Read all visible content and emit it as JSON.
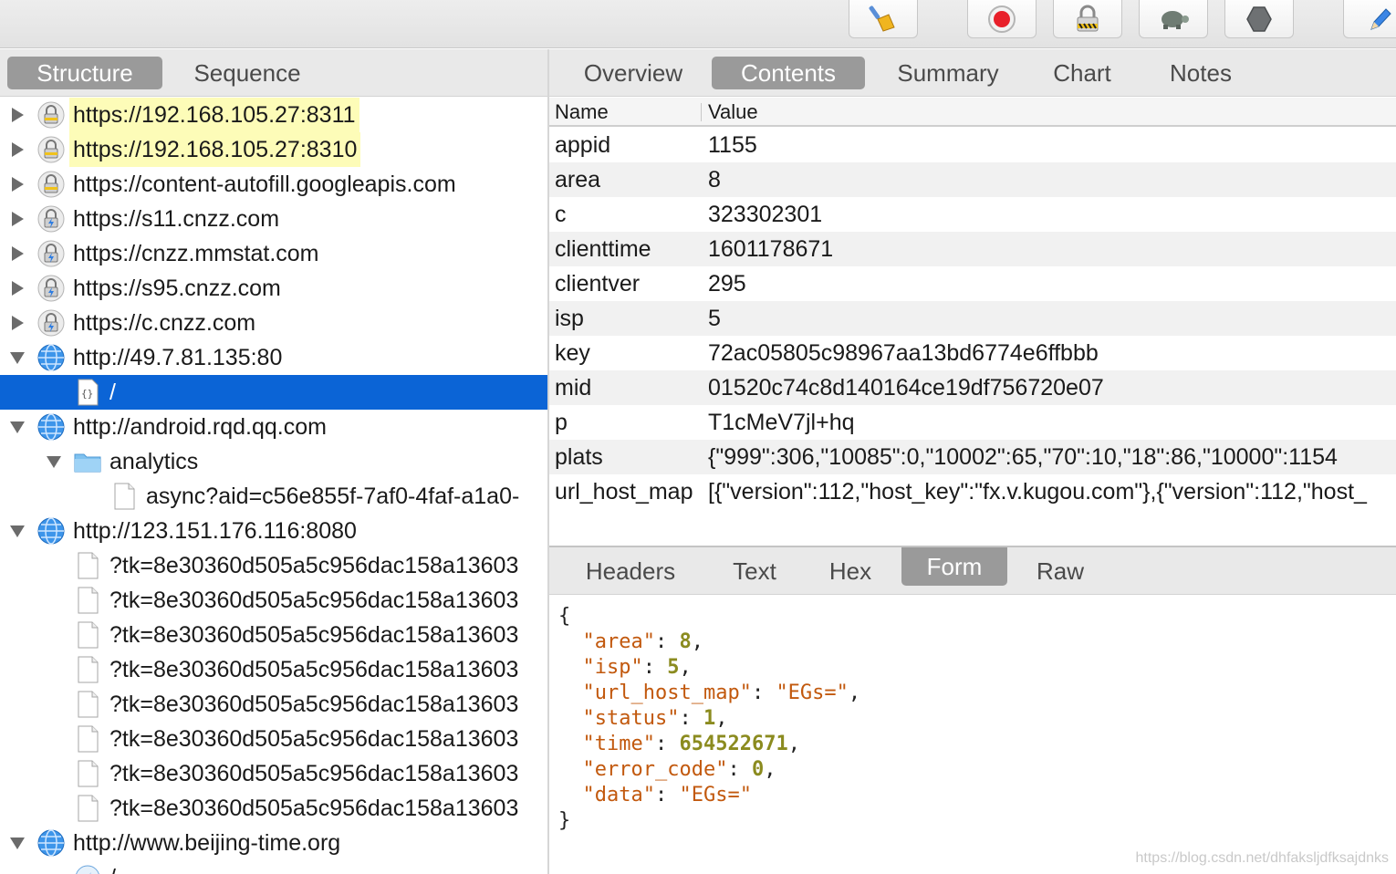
{
  "toolbar": {
    "buttons": [
      {
        "name": "broom-icon",
        "label": "Clear"
      },
      {
        "name": "record-icon",
        "label": "Record"
      },
      {
        "name": "ssl-lock-icon",
        "label": "SSL Proxying"
      },
      {
        "name": "turtle-icon",
        "label": "Throttle"
      },
      {
        "name": "stop-hexagon-icon",
        "label": "Breakpoints"
      },
      {
        "name": "pen-icon",
        "label": "Compose"
      }
    ]
  },
  "left_tabs": [
    {
      "label": "Structure",
      "active": true
    },
    {
      "label": "Sequence",
      "active": false
    }
  ],
  "tree": [
    {
      "level": 0,
      "expanded": false,
      "icon": "lock-icon",
      "label": "https://192.168.105.27:8311",
      "highlight": true
    },
    {
      "level": 0,
      "expanded": false,
      "icon": "lock-icon",
      "label": "https://192.168.105.27:8310",
      "highlight": true
    },
    {
      "level": 0,
      "expanded": false,
      "icon": "lock-icon",
      "label": "https://content-autofill.googleapis.com"
    },
    {
      "level": 0,
      "expanded": false,
      "icon": "lock-bolt-icon",
      "label": "https://s11.cnzz.com"
    },
    {
      "level": 0,
      "expanded": false,
      "icon": "lock-bolt-icon",
      "label": "https://cnzz.mmstat.com"
    },
    {
      "level": 0,
      "expanded": false,
      "icon": "lock-bolt-icon",
      "label": "https://s95.cnzz.com"
    },
    {
      "level": 0,
      "expanded": false,
      "icon": "lock-bolt-icon",
      "label": "https://c.cnzz.com"
    },
    {
      "level": 0,
      "expanded": true,
      "icon": "globe-icon",
      "label": "http://49.7.81.135:80"
    },
    {
      "level": 1,
      "icon": "json-file-icon",
      "label": "/",
      "selected": true
    },
    {
      "level": 0,
      "expanded": true,
      "icon": "globe-icon",
      "label": "http://android.rqd.qq.com"
    },
    {
      "level": 1,
      "expanded": true,
      "icon": "folder-icon",
      "label": "analytics"
    },
    {
      "level": 2,
      "icon": "file-icon",
      "label": "async?aid=c56e855f-7af0-4faf-a1a0-"
    },
    {
      "level": 0,
      "expanded": true,
      "icon": "globe-icon",
      "label": "http://123.151.176.116:8080"
    },
    {
      "level": 1,
      "icon": "file-icon",
      "label": "?tk=8e30360d505a5c956dac158a13603"
    },
    {
      "level": 1,
      "icon": "file-icon",
      "label": "?tk=8e30360d505a5c956dac158a13603"
    },
    {
      "level": 1,
      "icon": "file-icon",
      "label": "?tk=8e30360d505a5c956dac158a13603"
    },
    {
      "level": 1,
      "icon": "file-icon",
      "label": "?tk=8e30360d505a5c956dac158a13603"
    },
    {
      "level": 1,
      "icon": "file-icon",
      "label": "?tk=8e30360d505a5c956dac158a13603"
    },
    {
      "level": 1,
      "icon": "file-icon",
      "label": "?tk=8e30360d505a5c956dac158a13603"
    },
    {
      "level": 1,
      "icon": "file-icon",
      "label": "?tk=8e30360d505a5c956dac158a13603"
    },
    {
      "level": 1,
      "icon": "file-icon",
      "label": "?tk=8e30360d505a5c956dac158a13603"
    },
    {
      "level": 0,
      "expanded": true,
      "icon": "globe-icon",
      "label": "http://www.beijing-time.org"
    },
    {
      "level": 1,
      "icon": "compass-file-icon",
      "label": "/"
    }
  ],
  "right_tabs": [
    {
      "label": "Overview",
      "active": false
    },
    {
      "label": "Contents",
      "active": true
    },
    {
      "label": "Summary",
      "active": false
    },
    {
      "label": "Chart",
      "active": false
    },
    {
      "label": "Notes",
      "active": false
    }
  ],
  "grid": {
    "columns": [
      "Name",
      "Value"
    ],
    "rows": [
      {
        "name": "appid",
        "value": "1155"
      },
      {
        "name": "area",
        "value": "8"
      },
      {
        "name": "c",
        "value": "323302301"
      },
      {
        "name": "clienttime",
        "value": "1601178671"
      },
      {
        "name": "clientver",
        "value": "295"
      },
      {
        "name": "isp",
        "value": "5"
      },
      {
        "name": "key",
        "value": "72ac05805c98967aa13bd6774e6ffbbb"
      },
      {
        "name": "mid",
        "value": "01520c74c8d140164ce19df756720e07"
      },
      {
        "name": "p",
        "value": "T1cMeV7jl+hq"
      },
      {
        "name": "plats",
        "value": "{\"999\":306,\"10085\":0,\"10002\":65,\"70\":10,\"18\":86,\"10000\":1154"
      },
      {
        "name": "url_host_map",
        "value": "[{\"version\":112,\"host_key\":\"fx.v.kugou.com\"},{\"version\":112,\"host_"
      }
    ]
  },
  "bottom_tabs": [
    {
      "label": "Headers",
      "active": false
    },
    {
      "label": "Text",
      "active": false
    },
    {
      "label": "Hex",
      "active": false
    },
    {
      "label": "Form",
      "active": true
    },
    {
      "label": "Raw",
      "active": false
    }
  ],
  "json_view": {
    "open": "{",
    "close": "}",
    "entries": [
      {
        "key": "\"area\"",
        "value": "8",
        "type": "number",
        "comma": true
      },
      {
        "key": "\"isp\"",
        "value": "5",
        "type": "number",
        "comma": true
      },
      {
        "key": "\"url_host_map\"",
        "value": "\"EGs=\"",
        "type": "string",
        "comma": true
      },
      {
        "key": "\"status\"",
        "value": "1",
        "type": "number",
        "comma": true
      },
      {
        "key": "\"time\"",
        "value": "654522671",
        "type": "number",
        "comma": true
      },
      {
        "key": "\"error_code\"",
        "value": "0",
        "type": "number",
        "comma": true
      },
      {
        "key": "\"data\"",
        "value": "\"EGs=\"",
        "type": "string",
        "comma": false
      }
    ]
  },
  "watermark": "https://blog.csdn.net/dhfaksljdfksajdnks",
  "colors": {
    "selection": "#0b64d6",
    "active_tab": "#9a9a9a",
    "highlight": "#fdfcb8",
    "json_key": "#c2590e",
    "json_number": "#8b8b1f"
  }
}
